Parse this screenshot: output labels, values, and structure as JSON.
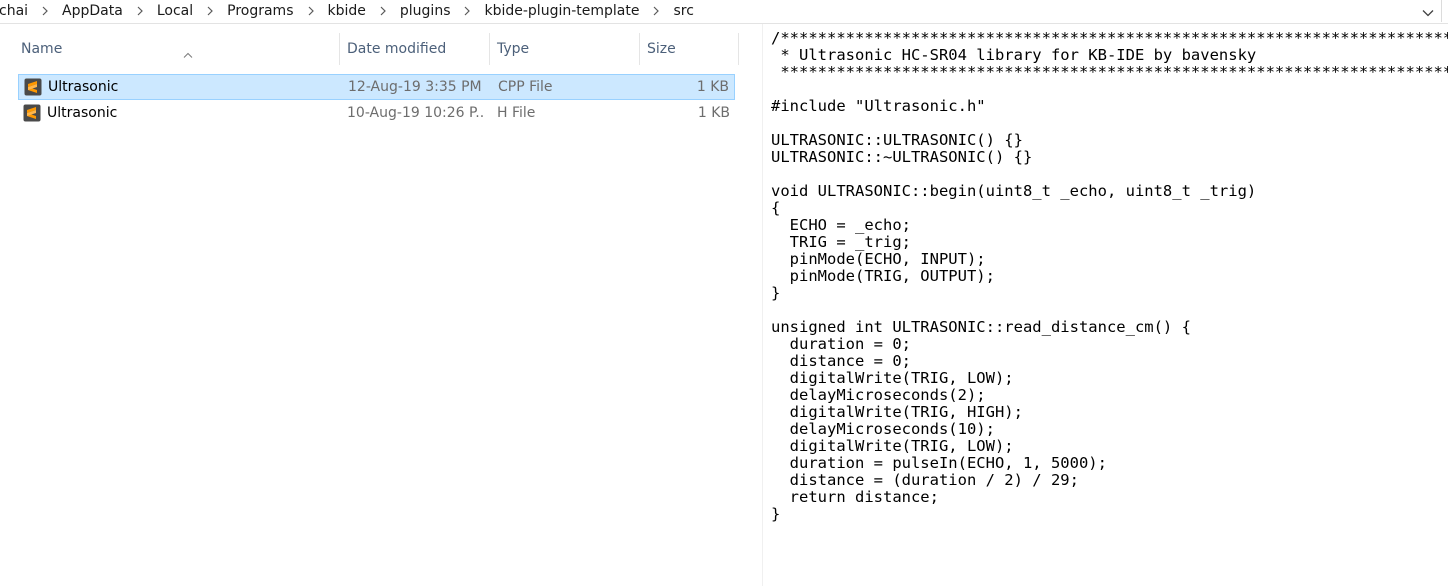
{
  "breadcrumb": {
    "items": [
      "chai",
      "AppData",
      "Local",
      "Programs",
      "kbide",
      "plugins",
      "kbide-plugin-template",
      "src"
    ]
  },
  "icons": {
    "separator": "chevron-right-icon",
    "dropdown": "chevron-down-icon",
    "sort": "sort-ascending-icon",
    "file": "sublime-text-file-icon"
  },
  "colors": {
    "selection_bg": "#cce8ff",
    "selection_border": "#99d1ff",
    "header_text": "#4c607a",
    "icon_bg": "#4a4a4a",
    "icon_accent": "#ff9800"
  },
  "columns": {
    "name": "Name",
    "date": "Date modified",
    "type": "Type",
    "size": "Size"
  },
  "files": [
    {
      "name": "Ultrasonic",
      "date": "12-Aug-19 3:35 PM",
      "type": "CPP File",
      "size": "1 KB",
      "selected": true
    },
    {
      "name": "Ultrasonic",
      "date": "10-Aug-19 10:26 P...",
      "type": "H File",
      "size": "1 KB",
      "selected": false
    }
  ],
  "preview": {
    "lines": [
      "/****************************************************************************",
      " * Ultrasonic HC-SR04 library for KB-IDE by bavensky",
      " *************************************************************************/",
      "",
      "#include \"Ultrasonic.h\"",
      "",
      "ULTRASONIC::ULTRASONIC() {}",
      "ULTRASONIC::~ULTRASONIC() {}",
      "",
      "void ULTRASONIC::begin(uint8_t _echo, uint8_t _trig)",
      "{",
      "  ECHO = _echo;",
      "  TRIG = _trig;",
      "  pinMode(ECHO, INPUT);",
      "  pinMode(TRIG, OUTPUT);",
      "}",
      "",
      "unsigned int ULTRASONIC::read_distance_cm() {",
      "  duration = 0;",
      "  distance = 0;",
      "  digitalWrite(TRIG, LOW);",
      "  delayMicroseconds(2);",
      "  digitalWrite(TRIG, HIGH);",
      "  delayMicroseconds(10);",
      "  digitalWrite(TRIG, LOW);",
      "  duration = pulseIn(ECHO, 1, 5000);",
      "  distance = (duration / 2) / 29;",
      "  return distance;",
      "}"
    ]
  }
}
